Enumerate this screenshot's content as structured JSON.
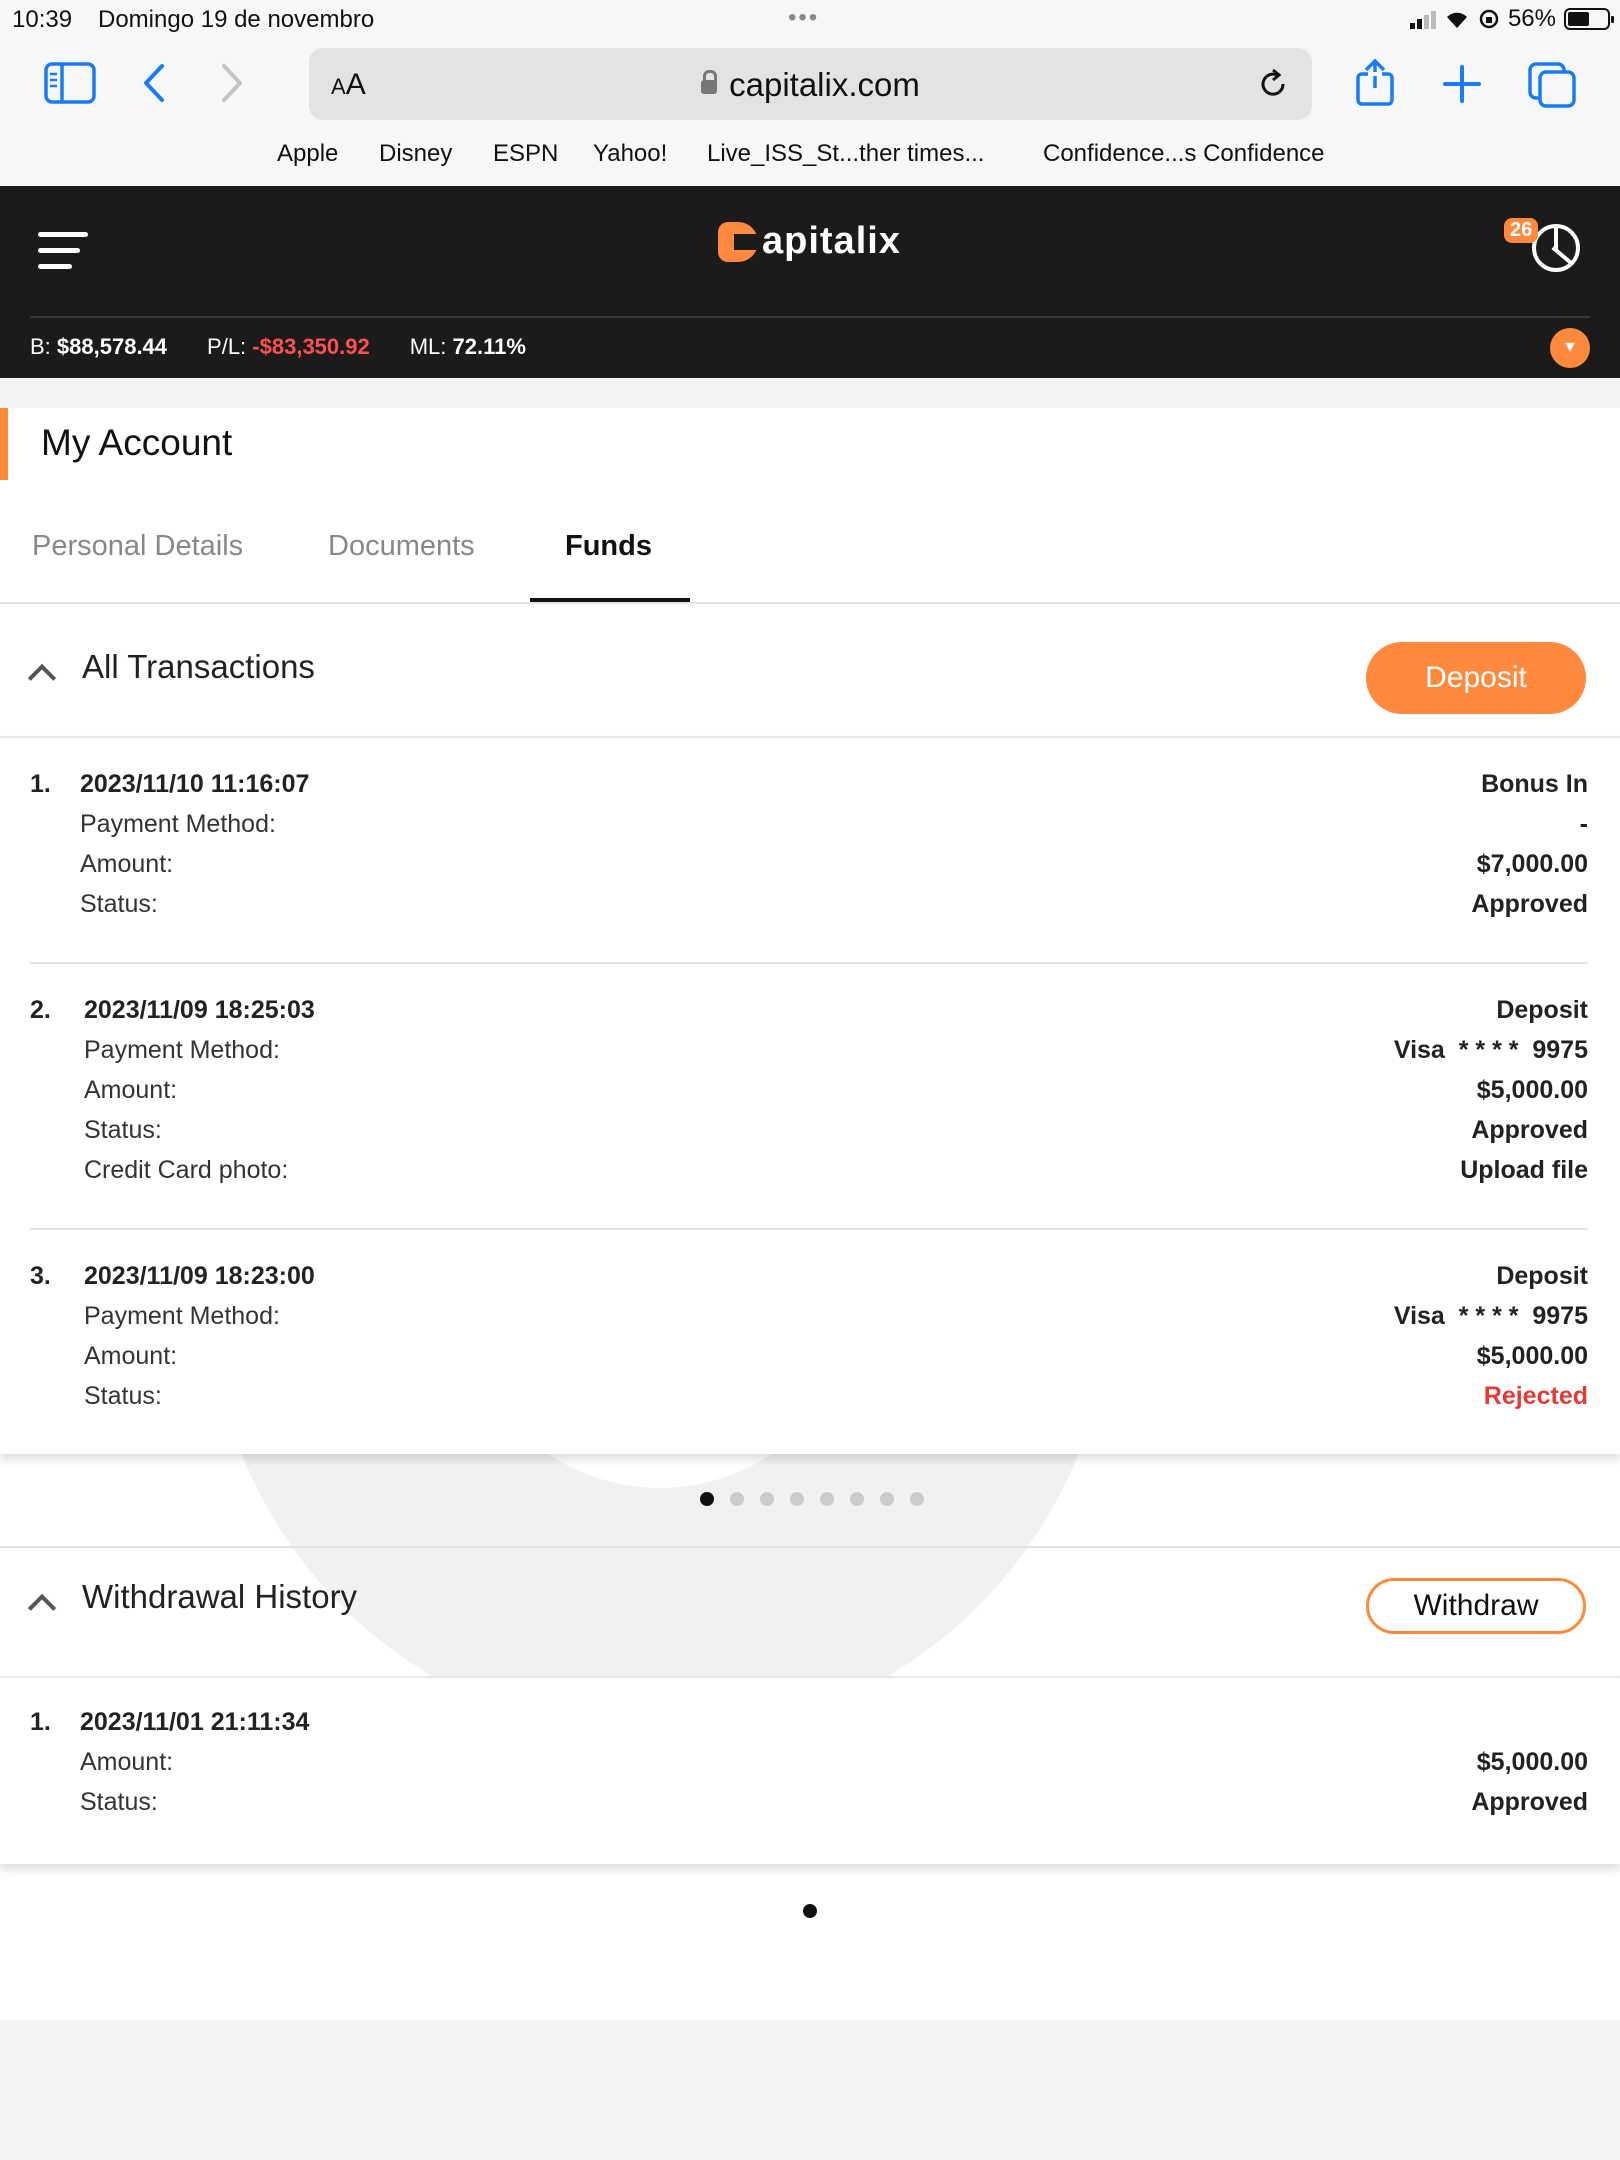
{
  "status_bar": {
    "time": "10:39",
    "date": "Domingo 19 de novembro",
    "battery": "56%"
  },
  "browser": {
    "aa_small": "A",
    "aa_big": "A",
    "url": "capitalix.com"
  },
  "bookmarks": [
    "Apple",
    "Disney",
    "ESPN",
    "Yahoo!",
    "Live_ISS_St...ther times...",
    "Confidence...s Confidence"
  ],
  "app": {
    "logo_text": "apitalix",
    "notifications": "26",
    "balance_label": "B:",
    "balance": "$88,578.44",
    "pl_label": "P/L:",
    "pl": "-$83,350.92",
    "ml_label": "ML:",
    "ml": "72.11%"
  },
  "account": {
    "title": "My Account",
    "tabs": [
      "Personal Details",
      "Documents",
      "Funds"
    ],
    "active_tab": "Funds"
  },
  "transactions": {
    "title": "All Transactions",
    "deposit_label": "Deposit",
    "items": [
      {
        "num": "1.",
        "datetime": "2023/11/10 11:16:07",
        "type": "Bonus In",
        "payment_label": "Payment Method:",
        "payment": "-",
        "amount_label": "Amount:",
        "amount": "$7,000.00",
        "status_label": "Status:",
        "status": "Approved"
      },
      {
        "num": "2.",
        "datetime": "2023/11/09 18:25:03",
        "type": "Deposit",
        "payment_label": "Payment Method:",
        "payment": "Visa  * * * *  9975",
        "amount_label": "Amount:",
        "amount": "$5,000.00",
        "status_label": "Status:",
        "status": "Approved",
        "photo_label": "Credit Card photo:",
        "photo": "Upload file"
      },
      {
        "num": "3.",
        "datetime": "2023/11/09 18:23:00",
        "type": "Deposit",
        "payment_label": "Payment Method:",
        "payment": "Visa  * * * *  9975",
        "amount_label": "Amount:",
        "amount": "$5,000.00",
        "status_label": "Status:",
        "status": "Rejected"
      }
    ],
    "page_count": 8,
    "current_page": 1
  },
  "withdrawals": {
    "title": "Withdrawal History",
    "withdraw_label": "Withdraw",
    "items": [
      {
        "num": "1.",
        "datetime": "2023/11/01 21:11:34",
        "amount_label": "Amount:",
        "amount": "$5,000.00",
        "status_label": "Status:",
        "status": "Approved"
      }
    ],
    "page_count": 1,
    "current_page": 1
  },
  "colors": {
    "accent": "#ff8a3d",
    "header_bg": "#1b1b1b",
    "negative": "#e53935"
  }
}
